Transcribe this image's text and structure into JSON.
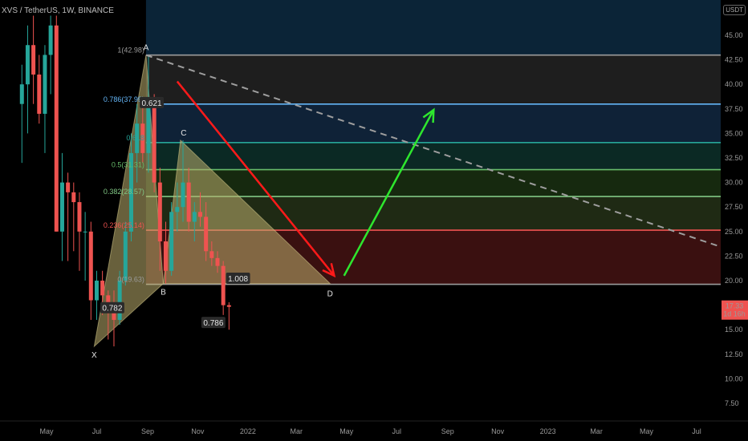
{
  "header": {
    "symbol": "XVS / TetherUS, 1W, BINANCE",
    "currency": "USDT"
  },
  "price_tag": {
    "value": "17.33",
    "countdown": "1d 16h"
  },
  "chart_data": {
    "type": "candlestick",
    "y_ticks": [
      7.5,
      10.0,
      12.5,
      15.0,
      17.5,
      20.0,
      22.5,
      25.0,
      27.5,
      30.0,
      32.5,
      35.0,
      37.5,
      40.0,
      42.5,
      45.0
    ],
    "x_ticks": [
      "May",
      "Jul",
      "Sep",
      "Nov",
      "2022",
      "Mar",
      "May",
      "Jul",
      "Sep",
      "Nov",
      "2023",
      "Mar",
      "May",
      "Jul"
    ],
    "x_tick_dates": [
      "2021-05-01",
      "2021-07-01",
      "2021-09-01",
      "2021-11-01",
      "2022-01-01",
      "2022-03-01",
      "2022-05-01",
      "2022-07-01",
      "2022-09-01",
      "2022-11-01",
      "2023-01-01",
      "2023-03-01",
      "2023-05-01",
      "2023-07-01"
    ],
    "ylim": [
      5.5,
      47
    ],
    "fib_levels": [
      {
        "ratio": "1",
        "price": 42.98,
        "label": "1(42.98)",
        "color": "#9b9b9b",
        "fill": "#1e1e1e"
      },
      {
        "ratio": "0.786",
        "price": 37.99,
        "label": "0.786(37.99)",
        "color": "#64b5f6",
        "fill": "#0f2237"
      },
      {
        "ratio": "0.618",
        "price": 34.07,
        "label": "0.618",
        "color": "#26a69a",
        "fill": "#0b2924"
      },
      {
        "ratio": "0.5",
        "price": 31.31,
        "label": "0.5(31.31)",
        "color": "#66bb6a",
        "fill": "#16290f"
      },
      {
        "ratio": "0.382",
        "price": 28.57,
        "label": "0.382(28.57)",
        "color": "#81c784",
        "fill": "#1f2a14"
      },
      {
        "ratio": "0.236",
        "price": 25.14,
        "label": "0.236(25.14)",
        "color": "#ef5350",
        "fill": "#3a1010"
      },
      {
        "ratio": "0",
        "price": 19.63,
        "label": "0(19.63)",
        "color": "#9b9b9b",
        "fill": null
      }
    ],
    "top_zone_color": "#0b2437",
    "pattern_points": [
      {
        "name": "X",
        "date": "2021-06-28",
        "price": 13.3
      },
      {
        "name": "A",
        "date": "2021-08-30",
        "price": 42.98
      },
      {
        "name": "B",
        "date": "2021-09-20",
        "price": 19.7
      },
      {
        "name": "C",
        "date": "2021-10-11",
        "price": 34.3
      },
      {
        "name": "D",
        "date": "2022-04-11",
        "price": 19.7
      }
    ],
    "ratio_labels": [
      {
        "text": "0.782",
        "date": "2021-07-20",
        "price": 17.0
      },
      {
        "text": "0.621",
        "date": "2021-09-06",
        "price": 37.9
      },
      {
        "text": "1.008",
        "date": "2021-12-20",
        "price": 20.0
      },
      {
        "text": "0.786",
        "date": "2021-11-20",
        "price": 15.5
      }
    ],
    "trendline": {
      "from": {
        "date": "2021-08-30",
        "price": 42.98
      },
      "to": {
        "date": "2023-08-01",
        "price": 23.4
      }
    },
    "red_arrow": {
      "from": {
        "date": "2021-10-07",
        "price": 40.3
      },
      "to": {
        "date": "2022-04-16",
        "price": 20.5
      }
    },
    "green_arrow": {
      "from": {
        "date": "2022-04-28",
        "price": 20.5
      },
      "to": {
        "date": "2022-08-15",
        "price": 37.4
      }
    },
    "candles": [
      {
        "date": "2021-04-01",
        "o": 38,
        "h": 42,
        "l": 32,
        "c": 40
      },
      {
        "date": "2021-04-08",
        "o": 40,
        "h": 46,
        "l": 35,
        "c": 44
      },
      {
        "date": "2021-04-15",
        "o": 44,
        "h": 47,
        "l": 38,
        "c": 41
      },
      {
        "date": "2021-04-22",
        "o": 41,
        "h": 43,
        "l": 36,
        "c": 37
      },
      {
        "date": "2021-04-29",
        "o": 37,
        "h": 44,
        "l": 33,
        "c": 43
      },
      {
        "date": "2021-05-06",
        "o": 43,
        "h": 47,
        "l": 39,
        "c": 46
      },
      {
        "date": "2021-05-13",
        "o": 46,
        "h": 47,
        "l": 25,
        "c": 25
      },
      {
        "date": "2021-05-20",
        "o": 25,
        "h": 33,
        "l": 22,
        "c": 30
      },
      {
        "date": "2021-05-27",
        "o": 30,
        "h": 31,
        "l": 22,
        "c": 29
      },
      {
        "date": "2021-06-03",
        "o": 29,
        "h": 30,
        "l": 23,
        "c": 28
      },
      {
        "date": "2021-06-10",
        "o": 28,
        "h": 29,
        "l": 21,
        "c": 25
      },
      {
        "date": "2021-06-17",
        "o": 25,
        "h": 27,
        "l": 20,
        "c": 25
      },
      {
        "date": "2021-06-24",
        "o": 25,
        "h": 26,
        "l": 16,
        "c": 18
      },
      {
        "date": "2021-07-01",
        "o": 18,
        "h": 21,
        "l": 16,
        "c": 20
      },
      {
        "date": "2021-07-08",
        "o": 20,
        "h": 21,
        "l": 16.5,
        "c": 18.5
      },
      {
        "date": "2021-07-15",
        "o": 18.5,
        "h": 19,
        "l": 14,
        "c": 17
      },
      {
        "date": "2021-07-22",
        "o": 17,
        "h": 19,
        "l": 13.3,
        "c": 16
      },
      {
        "date": "2021-07-29",
        "o": 16,
        "h": 21,
        "l": 15.5,
        "c": 20
      },
      {
        "date": "2021-08-05",
        "o": 20,
        "h": 26,
        "l": 19.5,
        "c": 25
      },
      {
        "date": "2021-08-12",
        "o": 25,
        "h": 35,
        "l": 24,
        "c": 33
      },
      {
        "date": "2021-08-19",
        "o": 33,
        "h": 38,
        "l": 30,
        "c": 36
      },
      {
        "date": "2021-08-26",
        "o": 36,
        "h": 38,
        "l": 32,
        "c": 33
      },
      {
        "date": "2021-09-02",
        "o": 33,
        "h": 42.98,
        "l": 31,
        "c": 38
      },
      {
        "date": "2021-09-09",
        "o": 38,
        "h": 39,
        "l": 29,
        "c": 30
      },
      {
        "date": "2021-09-16",
        "o": 30,
        "h": 31.5,
        "l": 21,
        "c": 24
      },
      {
        "date": "2021-09-23",
        "o": 24,
        "h": 26,
        "l": 19.7,
        "c": 21
      },
      {
        "date": "2021-09-30",
        "o": 21,
        "h": 28,
        "l": 20.5,
        "c": 27
      },
      {
        "date": "2021-10-07",
        "o": 27,
        "h": 30,
        "l": 25,
        "c": 27.5
      },
      {
        "date": "2021-10-14",
        "o": 27.5,
        "h": 34.3,
        "l": 26,
        "c": 30
      },
      {
        "date": "2021-10-21",
        "o": 30,
        "h": 31.5,
        "l": 25,
        "c": 26
      },
      {
        "date": "2021-10-28",
        "o": 26,
        "h": 28,
        "l": 24,
        "c": 27
      },
      {
        "date": "2021-11-04",
        "o": 27,
        "h": 29,
        "l": 25.5,
        "c": 26.5
      },
      {
        "date": "2021-11-11",
        "o": 26.5,
        "h": 28,
        "l": 22,
        "c": 23
      },
      {
        "date": "2021-11-18",
        "o": 23,
        "h": 24,
        "l": 21.5,
        "c": 22.3
      },
      {
        "date": "2021-11-25",
        "o": 22.3,
        "h": 23,
        "l": 20.8,
        "c": 21.5
      },
      {
        "date": "2021-12-02",
        "o": 21.5,
        "h": 22,
        "l": 16.5,
        "c": 17.5
      },
      {
        "date": "2021-12-09",
        "o": 17.5,
        "h": 17.8,
        "l": 15,
        "c": 17.33
      }
    ]
  }
}
